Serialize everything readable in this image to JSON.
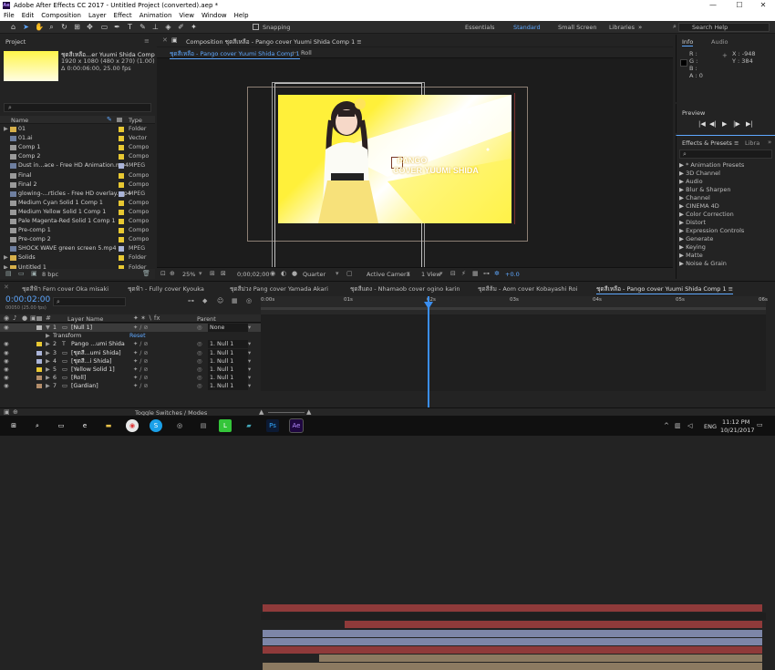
{
  "titlebar": {
    "title": "Adobe After Effects CC 2017 - Untitled Project (converted).aep *",
    "minimize": "—",
    "maximize": "☐",
    "close": "✕"
  },
  "menu": [
    "File",
    "Edit",
    "Composition",
    "Layer",
    "Effect",
    "Animation",
    "View",
    "Window",
    "Help"
  ],
  "toolbar": {
    "snapping": "Snapping",
    "workspaces": [
      "Essentials",
      "Standard",
      "Small Screen",
      "Libraries"
    ],
    "active_workspace": "Standard",
    "search_placeholder": "Search Help"
  },
  "project": {
    "tab": "Project",
    "comp_name": "ชุดสีเหลือ...er Yuumi Shida Comp 1 ▾",
    "comp_size": "1920 x 1080  (480 x 270) (1.00)",
    "comp_duration": "Δ 0:00:06:00, 25.00 fps",
    "search_placeholder": "⌕",
    "col_name": "Name",
    "col_type": "Type",
    "bpc": "8 bpc",
    "items": [
      {
        "name": "01",
        "type": "Folder",
        "label": "#e8c832",
        "kind": "folder"
      },
      {
        "name": "01.ai",
        "type": "Vector",
        "label": "#e8c832",
        "kind": "file"
      },
      {
        "name": "Comp 1",
        "type": "Compo",
        "label": "#e8c832",
        "kind": "comp"
      },
      {
        "name": "Comp 2",
        "type": "Compo",
        "label": "#e8c832",
        "kind": "comp"
      },
      {
        "name": "Dust in...ace - Free HD Animation.mp4",
        "type": "MPEG",
        "label": "#aab4d8",
        "kind": "file"
      },
      {
        "name": "Final",
        "type": "Compo",
        "label": "#e8c832",
        "kind": "comp"
      },
      {
        "name": "Final 2",
        "type": "Compo",
        "label": "#e8c832",
        "kind": "comp"
      },
      {
        "name": "glowing-...rticles - Free HD overlay.mp4",
        "type": "MPEG",
        "label": "#aab4d8",
        "kind": "file"
      },
      {
        "name": "Medium Cyan Solid 1 Comp 1",
        "type": "Compo",
        "label": "#e8c832",
        "kind": "comp"
      },
      {
        "name": "Medium Yellow Solid 1 Comp 1",
        "type": "Compo",
        "label": "#e8c832",
        "kind": "comp"
      },
      {
        "name": "Pale Magenta-Red Solid 1 Comp 1",
        "type": "Compo",
        "label": "#e8c832",
        "kind": "comp"
      },
      {
        "name": "Pre-comp 1",
        "type": "Compo",
        "label": "#e8c832",
        "kind": "comp"
      },
      {
        "name": "Pre-comp 2",
        "type": "Compo",
        "label": "#e8c832",
        "kind": "comp"
      },
      {
        "name": "SHOCK WAVE green screen 5.mp4",
        "type": "MPEG",
        "label": "#aab4d8",
        "kind": "file"
      },
      {
        "name": "Solids",
        "type": "Folder",
        "label": "#e8c832",
        "kind": "folder"
      },
      {
        "name": "Untitled 1",
        "type": "Folder",
        "label": "#e8c832",
        "kind": "folder"
      }
    ]
  },
  "composition": {
    "panel_tab": "Composition ชุดสีเหลือ - Pango cover Yuumi Shida Comp 1 ≡",
    "flow_tab": "ชุดสีเหลือ - Pango cover Yuumi Shida Comp 1",
    "flow_tab2": "Roll",
    "title_line1": "PANGO",
    "title_line2": "COVER YUUMI SHIDA",
    "footer": {
      "zoom": "25%",
      "timecode": "0;00;02;00",
      "resolution": "Quarter",
      "camera": "Active Camera",
      "view": "1 View",
      "exposure": "+0.0"
    }
  },
  "info": {
    "tab": "Info",
    "audio_tab": "Audio",
    "r": "R :",
    "g": "G :",
    "b": "B :",
    "a": "A : 0",
    "x": "X : -948",
    "y": "Y : 384"
  },
  "preview": {
    "tab": "Preview",
    "buttons": [
      "|◀",
      "◀|",
      "▶",
      "|▶",
      "▶|"
    ]
  },
  "effects": {
    "tab": "Effects & Presets ≡",
    "lib_tab": "Libra",
    "search_placeholder": "⌕",
    "items": [
      "* Animation Presets",
      "3D Channel",
      "Audio",
      "Blur & Sharpen",
      "Channel",
      "CINEMA 4D",
      "Color Correction",
      "Distort",
      "Expression Controls",
      "Generate",
      "Keying",
      "Matte",
      "Noise & Grain"
    ]
  },
  "timeline": {
    "tabs": [
      "ชุดสีฟ้า Fern cover Oka misaki",
      "ชุดฟ้า - Fully cover Kyouka",
      "ชุดสีม่วง Pang cover Yamada Akari",
      "ชุดสีแดง - Nhamaob cover ogino karin",
      "ชุดสีส้ม - Aom cover Kobayashi Roi",
      "ชุดสีเหลือ - Pango cover Yuumi Shida Comp 1 ≡"
    ],
    "timecode": "0:00:02:00",
    "timecode_sub": "00050 (25.00 fps)",
    "search_placeholder": "⌕",
    "col_layer": "Layer Name",
    "col_parent": "Parent",
    "ruler": [
      "0:00s",
      "01s",
      "02s",
      "03s",
      "04s",
      "05s",
      "06s"
    ],
    "transform_label": "Transform",
    "reset_label": "Reset",
    "toggle_label": "Toggle Switches / Modes",
    "layers": [
      {
        "num": "1",
        "name": "[Null 1]",
        "label": "#b7b7b7",
        "parent": "None",
        "bar": "#8f3a3a",
        "selected": true
      },
      {
        "num": "2",
        "name": "Pango ...umi Shida",
        "label": "#e8c832",
        "parent": "1. Null 1",
        "bar": "#8f3a3a",
        "text": true
      },
      {
        "num": "3",
        "name": "[ชุดสี...umi Shida]",
        "label": "#aab4d8",
        "parent": "1. Null 1",
        "bar": "#7d86a8"
      },
      {
        "num": "4",
        "name": "[ชุดสี...i Shida]",
        "label": "#aab4d8",
        "parent": "1. Null 1",
        "bar": "#7d86a8"
      },
      {
        "num": "5",
        "name": "[Yellow Solid 1]",
        "label": "#e8c832",
        "parent": "1. Null 1",
        "bar": "#8f3a3a"
      },
      {
        "num": "6",
        "name": "[Roll]",
        "label": "#b38d6a",
        "parent": "1. Null 1",
        "bar": "#8c7a61"
      },
      {
        "num": "7",
        "name": "[Gardian]",
        "label": "#b38d6a",
        "parent": "1. Null 1",
        "bar": "#8c7a61"
      }
    ]
  },
  "taskbar": {
    "time": "11:12 PM",
    "date": "10/21/2017",
    "lang": "ENG"
  }
}
